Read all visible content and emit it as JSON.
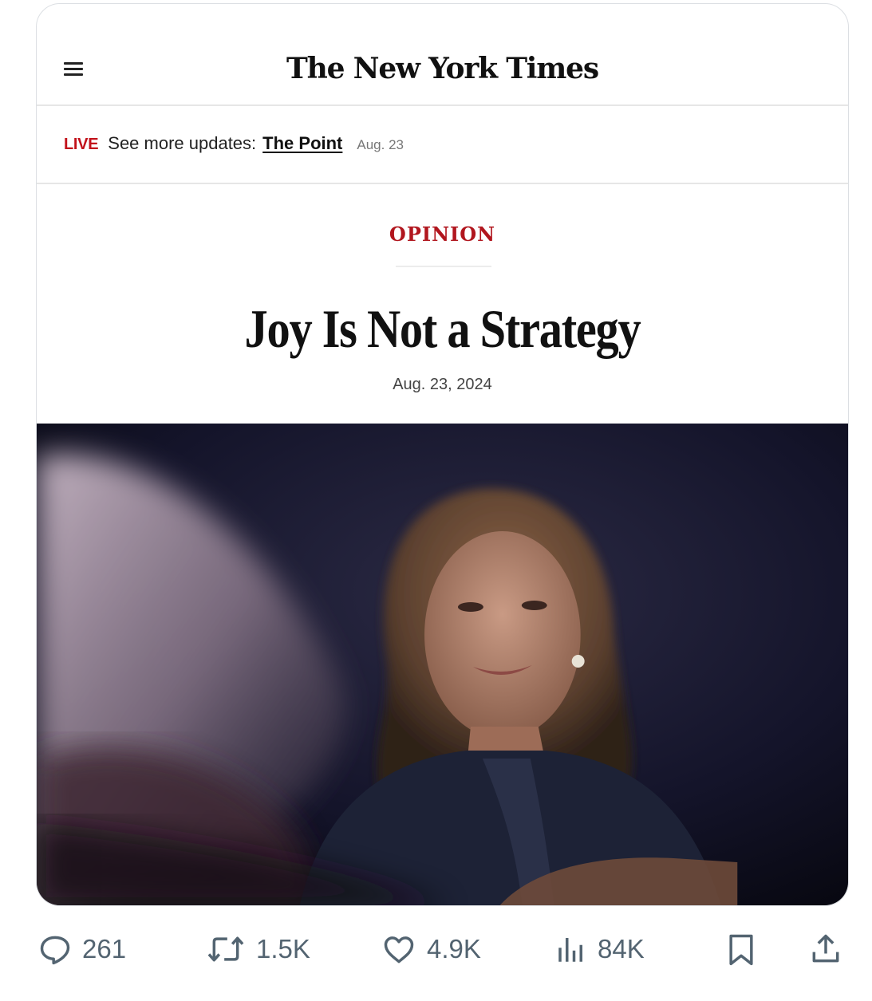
{
  "masthead": {
    "logo_text": "The New York Times",
    "menu_icon": "hamburger-menu-icon"
  },
  "live_bar": {
    "tag": "LIVE",
    "text": "See more updates:",
    "link": "The Point",
    "date": "Aug. 23"
  },
  "article": {
    "section": "OPINION",
    "headline": "Joy Is Not a Strategy",
    "date": "Aug. 23, 2024",
    "accent_color": "#b1161e"
  },
  "actions": {
    "replies": "261",
    "reposts": "1.5K",
    "likes": "4.9K",
    "views": "84K",
    "icons": [
      "reply-icon",
      "repost-icon",
      "like-icon",
      "views-icon",
      "bookmark-icon",
      "share-icon"
    ],
    "icon_color": "#536471"
  }
}
